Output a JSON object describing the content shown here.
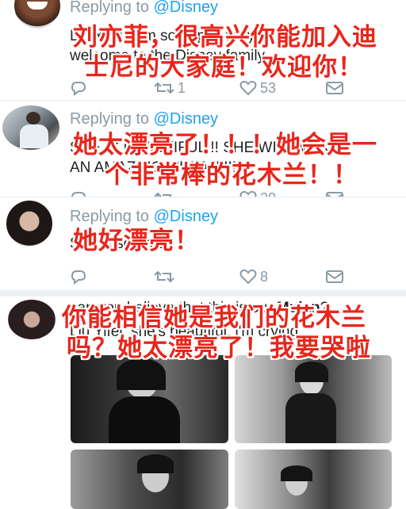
{
  "tweets": [
    {
      "reply_prefix": "Replying to ",
      "reply_handle": "@Disney",
      "body_line1": "Liu Yifei I am so happy for you and",
      "body_line2": "welcome to the Disney family",
      "retweets": "1",
      "likes": "53",
      "overlay_line1": "刘亦菲，很高兴你能加入迪",
      "overlay_line2": "士尼的大家庭！欢迎你！"
    },
    {
      "reply_prefix": "Replying to ",
      "reply_handle": "@Disney",
      "body_line1": "SHE IS BEAUTIFUL!!! SHE WILL MAKE",
      "body_line2": "AN AMAZING MULAN!!!!",
      "retweets": "",
      "likes": "20",
      "overlay_line1": "她太漂亮了！！！她会是一",
      "overlay_line2": "个非常棒的花木兰！！"
    },
    {
      "reply_prefix": "Replying to ",
      "reply_handle": "@Disney",
      "body_line1": "She is so pretty",
      "retweets": "",
      "likes": "8",
      "overlay_line1": "她好漂亮！"
    },
    {
      "body_line1_pre": "can you believe that this is our ",
      "body_line1_bold": "Mulan",
      "body_line1_post": "?",
      "body_line2": "Liu Yifei, she's beautiful, i'm crying",
      "overlay_line1": "你能相信她是我们的花木兰",
      "overlay_line2": "吗？她太漂亮了！我要哭啦"
    }
  ],
  "colors": {
    "accent": "#1da1f2",
    "meta": "#8a9aa6",
    "overlay": "#e8261c"
  },
  "icons": [
    "reply-icon",
    "retweet-icon",
    "like-icon",
    "dm-icon"
  ]
}
